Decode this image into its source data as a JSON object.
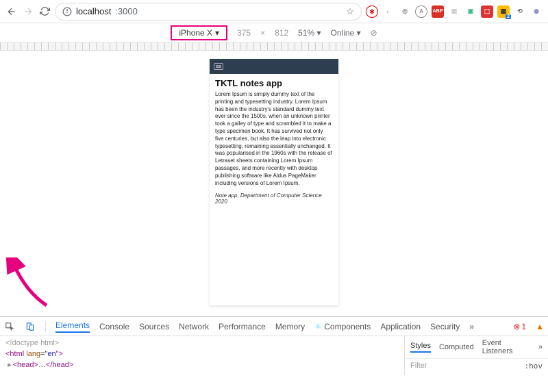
{
  "browser": {
    "url_host": "localhost",
    "url_port": ":3000",
    "extensions": {
      "ublock": "",
      "abp": "ABP",
      "badge2": "2"
    }
  },
  "deviceBar": {
    "device": "iPhone X",
    "width": "375",
    "times": "×",
    "height": "812",
    "zoom": "51%",
    "throttle": "Online"
  },
  "page": {
    "title": "TKTL notes app",
    "body": "Lorem Ipsum is simply dummy text of the printing and typesetting industry. Lorem Ipsum has been the industry's standard dummy text ever since the 1500s, when an unknown printer took a galley of type and scrambled it to make a type specimen book. It has survived not only five centuries, but also the leap into electronic typesetting, remaining essentially unchanged. It was popularised in the 1960s with the release of Letraset sheets containing Lorem Ipsum passages, and more recently with desktop publishing software like Aldus PageMaker including versions of Lorem Ipsum.",
    "footer": "Note app, Department of Computer Science 2020"
  },
  "devtools": {
    "tabs": {
      "elements": "Elements",
      "console": "Console",
      "sources": "Sources",
      "network": "Network",
      "performance": "Performance",
      "memory": "Memory",
      "components": "Components",
      "application": "Application",
      "security": "Security"
    },
    "errors": "1",
    "warnings": "",
    "code": {
      "doctype": "<!doctype html>",
      "html_open": "<html ",
      "lang_attr": "lang",
      "lang_eq": "=\"",
      "lang_val": "en",
      "lang_close": "\">",
      "head": "<head>",
      "ellipsis": "…",
      "head_close": "</head>"
    },
    "side": {
      "styles": "Styles",
      "computed": "Computed",
      "listeners": "Event Listeners",
      "filter": "Filter",
      "hov": ":hov"
    }
  }
}
